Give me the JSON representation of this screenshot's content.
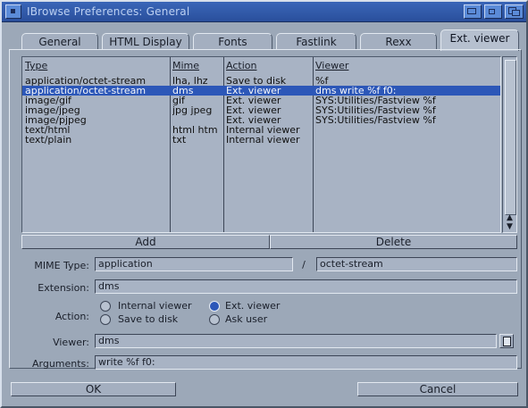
{
  "window": {
    "title": "IBrowse Preferences: General"
  },
  "tabs": [
    {
      "label": "General"
    },
    {
      "label": "HTML Display"
    },
    {
      "label": "Fonts"
    },
    {
      "label": "Fastlink"
    },
    {
      "label": "Rexx"
    },
    {
      "label": "Ext. viewer"
    }
  ],
  "active_tab": "Ext. viewer",
  "list": {
    "headers": [
      "Type",
      "Mime",
      "Action",
      "Viewer"
    ],
    "rows": [
      [
        "application/octet-stream",
        "lha, lhz",
        "Save to disk",
        "%f"
      ],
      [
        "application/octet-stream",
        "dms",
        "Ext. viewer",
        "dms write %f f0:"
      ],
      [
        "image/gif",
        "gif",
        "Ext. viewer",
        "SYS:Utilities/Fastview %f"
      ],
      [
        "image/jpeg",
        "jpg jpeg",
        "Ext. viewer",
        "SYS:Utilities/Fastview %f"
      ],
      [
        "image/pjpeg",
        "",
        "Ext. viewer",
        "SYS:Utilities/Fastview %f"
      ],
      [
        "text/html",
        "html htm",
        "Internal viewer",
        ""
      ],
      [
        "text/plain",
        "txt",
        "Internal viewer",
        ""
      ]
    ],
    "selected_index": 1
  },
  "buttons": {
    "add": "Add",
    "delete": "Delete",
    "ok": "OK",
    "cancel": "Cancel"
  },
  "form": {
    "mime_type_label": "MIME Type:",
    "mime_type_value": "application",
    "mime_sep": "/",
    "mime_subtype_value": "octet-stream",
    "extension_label": "Extension:",
    "extension_value": "dms",
    "action_label": "Action:",
    "action_options": [
      "Internal viewer",
      "Ext. viewer",
      "Save to disk",
      "Ask user"
    ],
    "action_selected": "Ext. viewer",
    "viewer_label": "Viewer:",
    "viewer_value": "dms",
    "arguments_label": "Arguments:",
    "arguments_value": "write %f f0:"
  },
  "colors": {
    "title_bar": "#2a4f9c",
    "selection": "#2c57b8",
    "panel": "#9ca8b8"
  }
}
